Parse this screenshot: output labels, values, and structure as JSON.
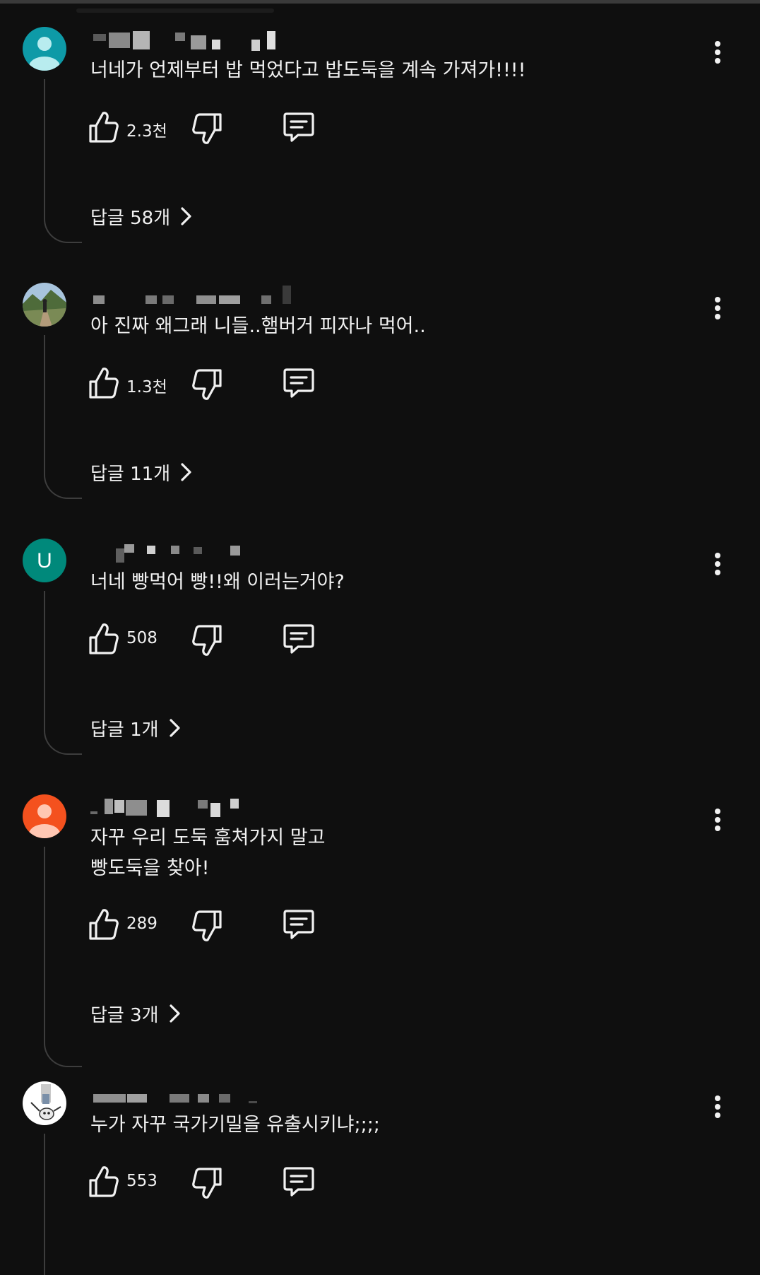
{
  "comments": [
    {
      "text": "너네가 언제부터 밥 먹었다고 밥도둑을 계속 가져가!!!!",
      "likes": "2.3천",
      "replies": "답글 58개",
      "avatar": "person-icon",
      "avatar_bg": "#0e9aa7"
    },
    {
      "text": "아 진짜 왜그래 니들..햄버거 피자나 먹어..",
      "likes": "1.3천",
      "replies": "답글 11개",
      "avatar": "landscape-photo",
      "avatar_bg": "#6b8b5a"
    },
    {
      "text": "너네 빵먹어 빵!!왜 이러는거야?",
      "likes": "508",
      "replies": "답글 1개",
      "avatar": "letter",
      "avatar_letter": "U",
      "avatar_bg": "#00897b"
    },
    {
      "text": "자꾸 우리 도둑 훔쳐가지 말고\n빵도둑을 찾아!",
      "likes": "289",
      "replies": "답글 3개",
      "avatar": "person-icon",
      "avatar_bg": "#f4511e"
    },
    {
      "text": "누가 자꾸 국가기밀을 유출시키냐;;;;",
      "likes": "553",
      "replies": "",
      "avatar": "cartoon-photo",
      "avatar_bg": "#ffffff"
    }
  ],
  "icons": {
    "like": "thumb-up-icon",
    "dislike": "thumb-down-icon",
    "reply": "comment-icon",
    "more": "more-vert-icon",
    "chevron": "chevron-right-icon"
  },
  "colors": {
    "background": "#0f0f0f",
    "text": "#f1f1f1",
    "thread_line": "#3d3d3d"
  }
}
